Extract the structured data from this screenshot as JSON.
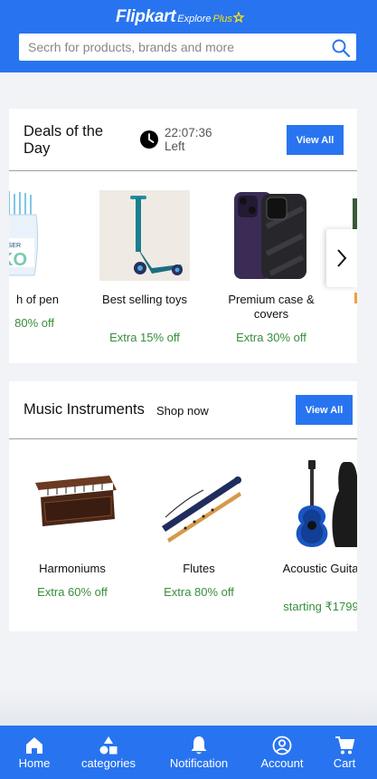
{
  "header": {
    "brand": "Flipkart",
    "explore": "Explore",
    "plus": "Plus",
    "search_placeholder": "Secrh for products, brands and more"
  },
  "deals": {
    "title": "Deals of the Day",
    "timer_time": "22:07:36",
    "timer_label": "Left",
    "view_all": "View All",
    "items": [
      {
        "name": "h of pen",
        "offer": "80% off",
        "icon": "pen-jar-image"
      },
      {
        "name": "Best selling toys",
        "offer": "Extra 15% off",
        "icon": "scooter-image"
      },
      {
        "name": "Premium case & covers",
        "offer": "Extra 30% off",
        "icon": "phone-case-image"
      }
    ]
  },
  "music": {
    "title": "Music Instruments",
    "shop_now": "Shop now",
    "view_all": "View All",
    "items": [
      {
        "name": "Harmoniums",
        "offer": "Extra 60% off",
        "icon": "harmonium-image"
      },
      {
        "name": "Flutes",
        "offer": "Extra 80% off",
        "icon": "flute-image"
      },
      {
        "name": "Acoustic Guitars",
        "offer": "starting ₹1799",
        "icon": "guitar-image"
      }
    ]
  },
  "nav": {
    "home": "Home",
    "categories": "categories",
    "notification": "Notification",
    "account": "Account",
    "cart": "Cart"
  },
  "colors": {
    "brand_blue": "#2874f0",
    "offer_green": "#388e3c",
    "plus_yellow": "#ffe500"
  }
}
